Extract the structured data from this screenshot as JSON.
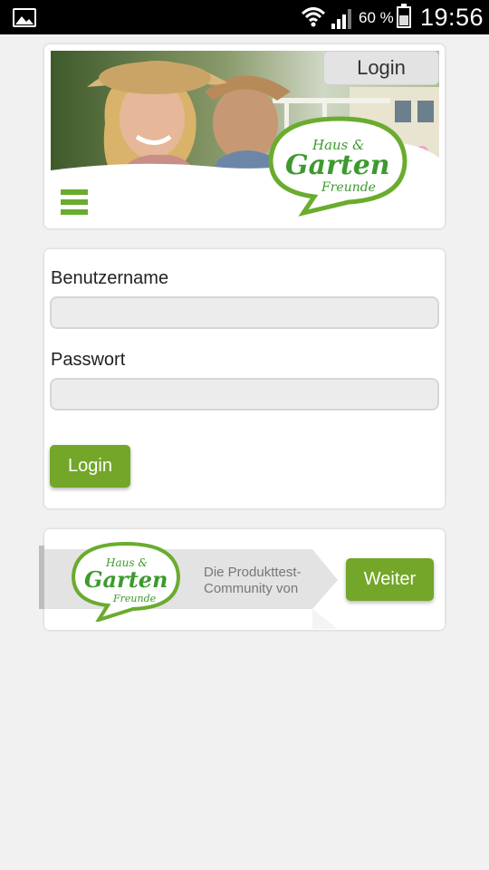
{
  "status_bar": {
    "battery_percent": "60 %",
    "battery_level": 0.6,
    "time": "19:56",
    "icons": [
      "gallery-icon",
      "wifi-icon",
      "signal-icon",
      "battery-icon"
    ]
  },
  "header": {
    "login_button": "Login",
    "logo": {
      "line1": "Haus &",
      "line2": "Garten",
      "line3": "Freunde"
    },
    "menu_icon": "hamburger-menu-icon"
  },
  "login_form": {
    "username_label": "Benutzername",
    "username_value": "",
    "password_label": "Passwort",
    "password_value": "",
    "submit_label": "Login"
  },
  "promo": {
    "text_line1": "Die Produkttest-",
    "text_line2": "Community von",
    "button_label": "Weiter"
  },
  "colors": {
    "brand_green": "#73a629",
    "logo_green": "#3d9a2e",
    "background": "#f1f1f1"
  }
}
